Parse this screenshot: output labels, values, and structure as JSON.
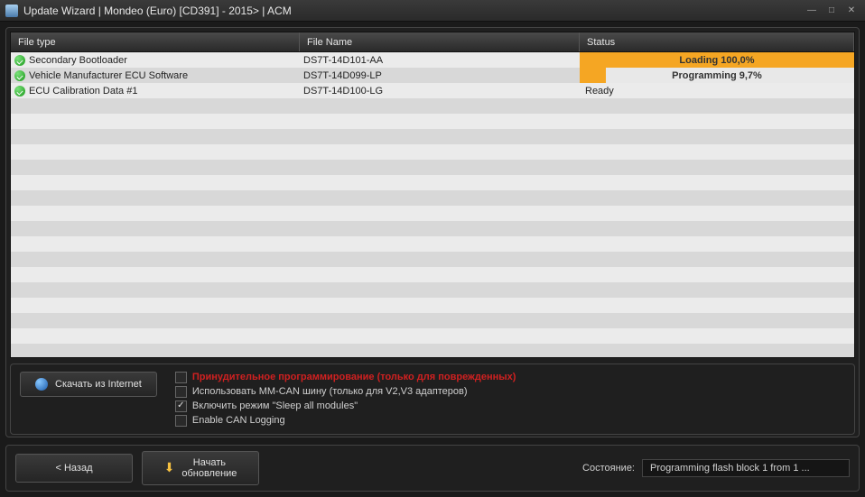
{
  "window": {
    "title": "Update Wizard | Mondeo (Euro) [CD391] - 2015> | ACM"
  },
  "table": {
    "headers": {
      "filetype": "File type",
      "filename": "File Name",
      "status": "Status"
    },
    "rows": [
      {
        "filetype": "Secondary Bootloader",
        "filename": "DS7T-14D101-AA",
        "status": {
          "mode": "progress",
          "label": "Loading 100,0%",
          "percent": 100
        }
      },
      {
        "filetype": "Vehicle Manufacturer ECU Software",
        "filename": "DS7T-14D099-LP",
        "status": {
          "mode": "progress",
          "label": "Programming 9,7%",
          "percent": 9.7
        }
      },
      {
        "filetype": "ECU Calibration Data #1",
        "filename": "DS7T-14D100-LG",
        "status": {
          "mode": "text",
          "label": "Ready"
        }
      }
    ]
  },
  "options": {
    "download_btn": "Скачать из Internet",
    "items": [
      {
        "label": "Принудительное программирование (только для поврежденных)",
        "checked": false,
        "red": true
      },
      {
        "label": "Использовать MM-CAN шину (только для V2,V3 адаптеров)",
        "checked": false,
        "red": false
      },
      {
        "label": "Включить режим \"Sleep all modules\"",
        "checked": true,
        "red": false
      },
      {
        "label": "Enable CAN Logging",
        "checked": false,
        "red": false
      }
    ]
  },
  "footer": {
    "back_btn": "< Назад",
    "start_btn_line1": "Начать",
    "start_btn_line2": "обновление",
    "status_label": "Состояние:",
    "status_value": "Programming flash block 1 from 1 ..."
  }
}
